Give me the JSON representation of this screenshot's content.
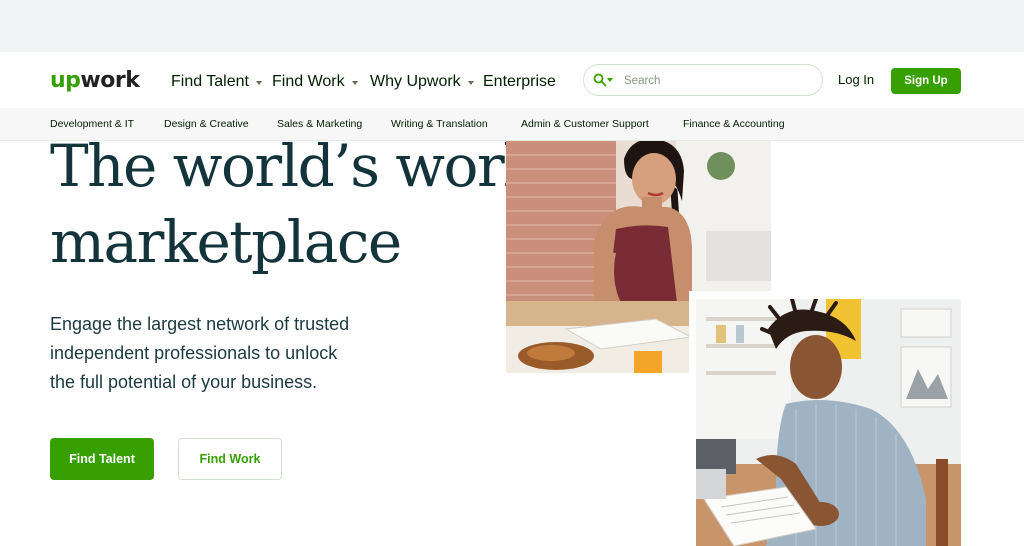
{
  "header": {
    "logo_text_up": "up",
    "logo_text_work": "work",
    "nav": [
      {
        "label": "Find Talent",
        "has_dropdown": true
      },
      {
        "label": "Find Work",
        "has_dropdown": true
      },
      {
        "label": "Why Upwork",
        "has_dropdown": true
      },
      {
        "label": "Enterprise",
        "has_dropdown": false
      }
    ],
    "search": {
      "placeholder": "Search",
      "value": ""
    },
    "login_label": "Log In",
    "signup_label": "Sign Up"
  },
  "categories": [
    "Development & IT",
    "Design & Creative",
    "Sales & Marketing",
    "Writing & Translation",
    "Admin & Customer Support",
    "Finance & Accounting"
  ],
  "hero": {
    "title_line1": "The world’s work",
    "title_line2": "marketplace",
    "subtitle_line1": "Engage the largest network of trusted",
    "subtitle_line2": "independent professionals to unlock",
    "subtitle_line3": "the full potential of your business.",
    "primary_button": "Find Talent",
    "secondary_button": "Find Work"
  },
  "colors": {
    "brand_green": "#37a000",
    "title_color": "#13343b",
    "text_dark": "#001e00"
  },
  "icons": [
    "search-icon",
    "chevron-down-icon"
  ]
}
